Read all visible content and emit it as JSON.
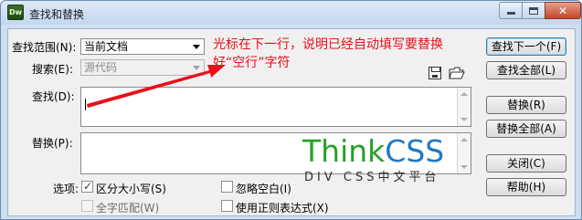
{
  "window": {
    "title": "查找和替换",
    "app_icon_text": "Dw"
  },
  "form": {
    "scope_label": "查找范围(N):",
    "scope_value": "当前文档",
    "search_label": "搜索(E):",
    "search_value": "源代码",
    "find_label": "查找(D):",
    "find_value": "",
    "replace_label": "替换(P):",
    "replace_value": "",
    "options_label": "选项:"
  },
  "options": {
    "match_case": {
      "label": "区分大小写(S)",
      "checked": true
    },
    "whole_word": {
      "label": "全字匹配(W)",
      "checked": false,
      "disabled": true
    },
    "ignore_whitespace": {
      "label": "忽略空白(I)",
      "checked": false
    },
    "regex": {
      "label": "使用正则表达式(X)",
      "checked": false
    }
  },
  "buttons": {
    "find_next": "查找下一个(F)",
    "find_all": "查找全部(L)",
    "replace": "替换(R)",
    "replace_all": "替换全部(A)",
    "close": "关闭(C)",
    "help": "帮助(H)"
  },
  "toolbar_icons": [
    "save-query-icon",
    "load-query-icon"
  ],
  "annotation": {
    "line1": "光标在下一行，说明已经自动填写要替换",
    "line2": "好“空行”字符",
    "color": "#e8101a"
  },
  "watermark": {
    "brand_part1": "Think",
    "brand_part2": "CSS",
    "tagline": "DIV CSS中文平台",
    "color1": "#27a027",
    "color2": "#1f79c4"
  }
}
